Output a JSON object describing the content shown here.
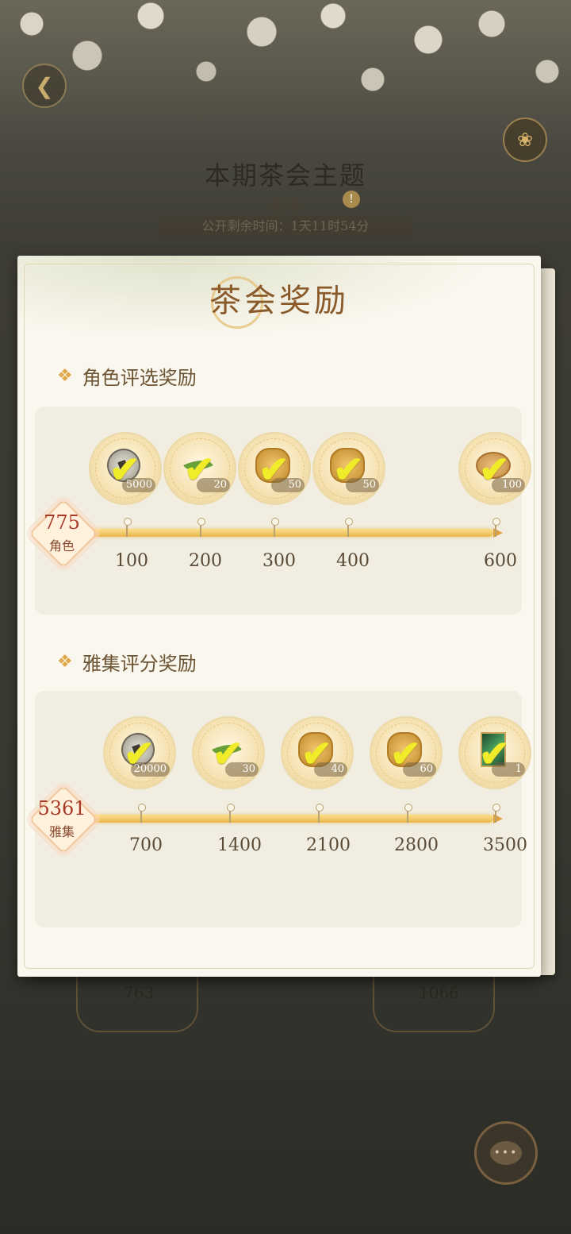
{
  "background": {
    "theme_title": "本期茶会主题",
    "theme_name": "祓禊",
    "countdown": "公开剩余时间：1天11时54分",
    "left_count": "763",
    "right_count": "1066"
  },
  "modal": {
    "title": "茶会奖励",
    "sections": [
      {
        "heading": "角色评选奖励",
        "score_value": "775",
        "score_caption": "角色",
        "rewards": [
          {
            "item": "copper-coin-icon",
            "qty": "5000"
          },
          {
            "item": "tea-leaf-icon",
            "qty": "20"
          },
          {
            "item": "golden-knot-icon",
            "qty": "50"
          },
          {
            "item": "golden-knot-icon",
            "qty": "50"
          },
          {
            "item": "mooncake-icon",
            "qty": "100"
          }
        ],
        "ticks": [
          "100",
          "200",
          "300",
          "400",
          "600"
        ]
      },
      {
        "heading": "雅集评分奖励",
        "score_value": "5361",
        "score_caption": "雅集",
        "rewards": [
          {
            "item": "copper-coin-icon",
            "qty": "20000"
          },
          {
            "item": "tea-leaf-icon",
            "qty": "30"
          },
          {
            "item": "golden-knot-icon",
            "qty": "40"
          },
          {
            "item": "golden-knot-icon",
            "qty": "60"
          },
          {
            "item": "jade-card-icon",
            "qty": "1"
          }
        ],
        "ticks": [
          "700",
          "1400",
          "2100",
          "2800",
          "3500"
        ]
      }
    ]
  },
  "colors": {
    "accent_gold": "#eab64e",
    "title_brown": "#8a5a2a",
    "score_red": "#a83a28",
    "check_yellow": "#f1ec2a"
  }
}
